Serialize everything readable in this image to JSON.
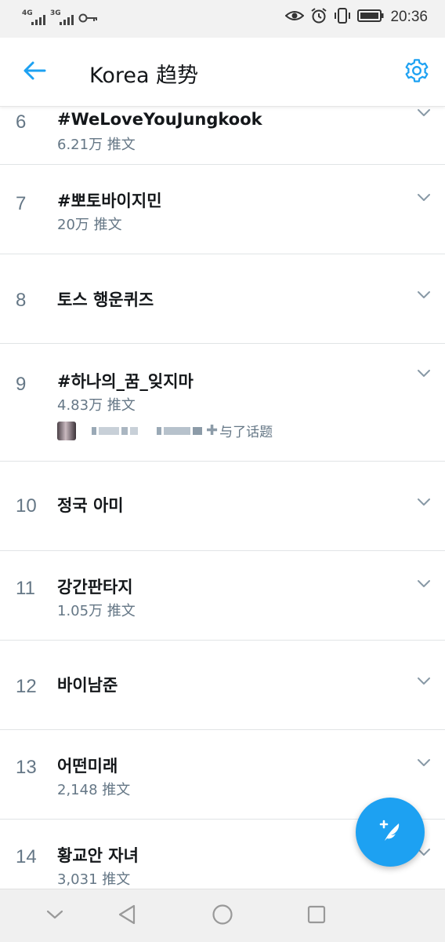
{
  "status_bar": {
    "network_1": "4G",
    "network_2": "3G",
    "time": "20:36",
    "icons": [
      "signal-icon",
      "key-icon",
      "eye-icon",
      "alarm-icon",
      "vibrate-icon",
      "battery-icon"
    ]
  },
  "header": {
    "title": "Korea 趋势",
    "back_icon": "arrow-left-icon",
    "settings_icon": "gear-icon"
  },
  "trends": [
    {
      "rank": "6",
      "topic": "#WeLoveYouJungkook",
      "count": "6.21万 推文"
    },
    {
      "rank": "7",
      "topic": "#뽀토바이지민",
      "count": "20万 推文"
    },
    {
      "rank": "8",
      "topic": "토스 행운퀴즈",
      "count": ""
    },
    {
      "rank": "9",
      "topic": "#하나의_꿈_잊지마",
      "count": "4.83万 推文",
      "context": "与了话题"
    },
    {
      "rank": "10",
      "topic": "정국 아미",
      "count": ""
    },
    {
      "rank": "11",
      "topic": "강간판타지",
      "count": "1.05万 推文"
    },
    {
      "rank": "12",
      "topic": "바이남준",
      "count": ""
    },
    {
      "rank": "13",
      "topic": "어떤미래",
      "count": "2,148 推文"
    },
    {
      "rank": "14",
      "topic": "황교안 자녀",
      "count": "3,031 推文"
    }
  ],
  "fab": {
    "icon": "compose-tweet-icon"
  },
  "nav": {
    "icons": [
      "hide-keyboard-icon",
      "back-triangle-icon",
      "home-circle-icon",
      "recents-square-icon"
    ]
  },
  "colors": {
    "accent": "#1da1f2",
    "secondary_text": "#657786",
    "primary_text": "#14171a"
  }
}
